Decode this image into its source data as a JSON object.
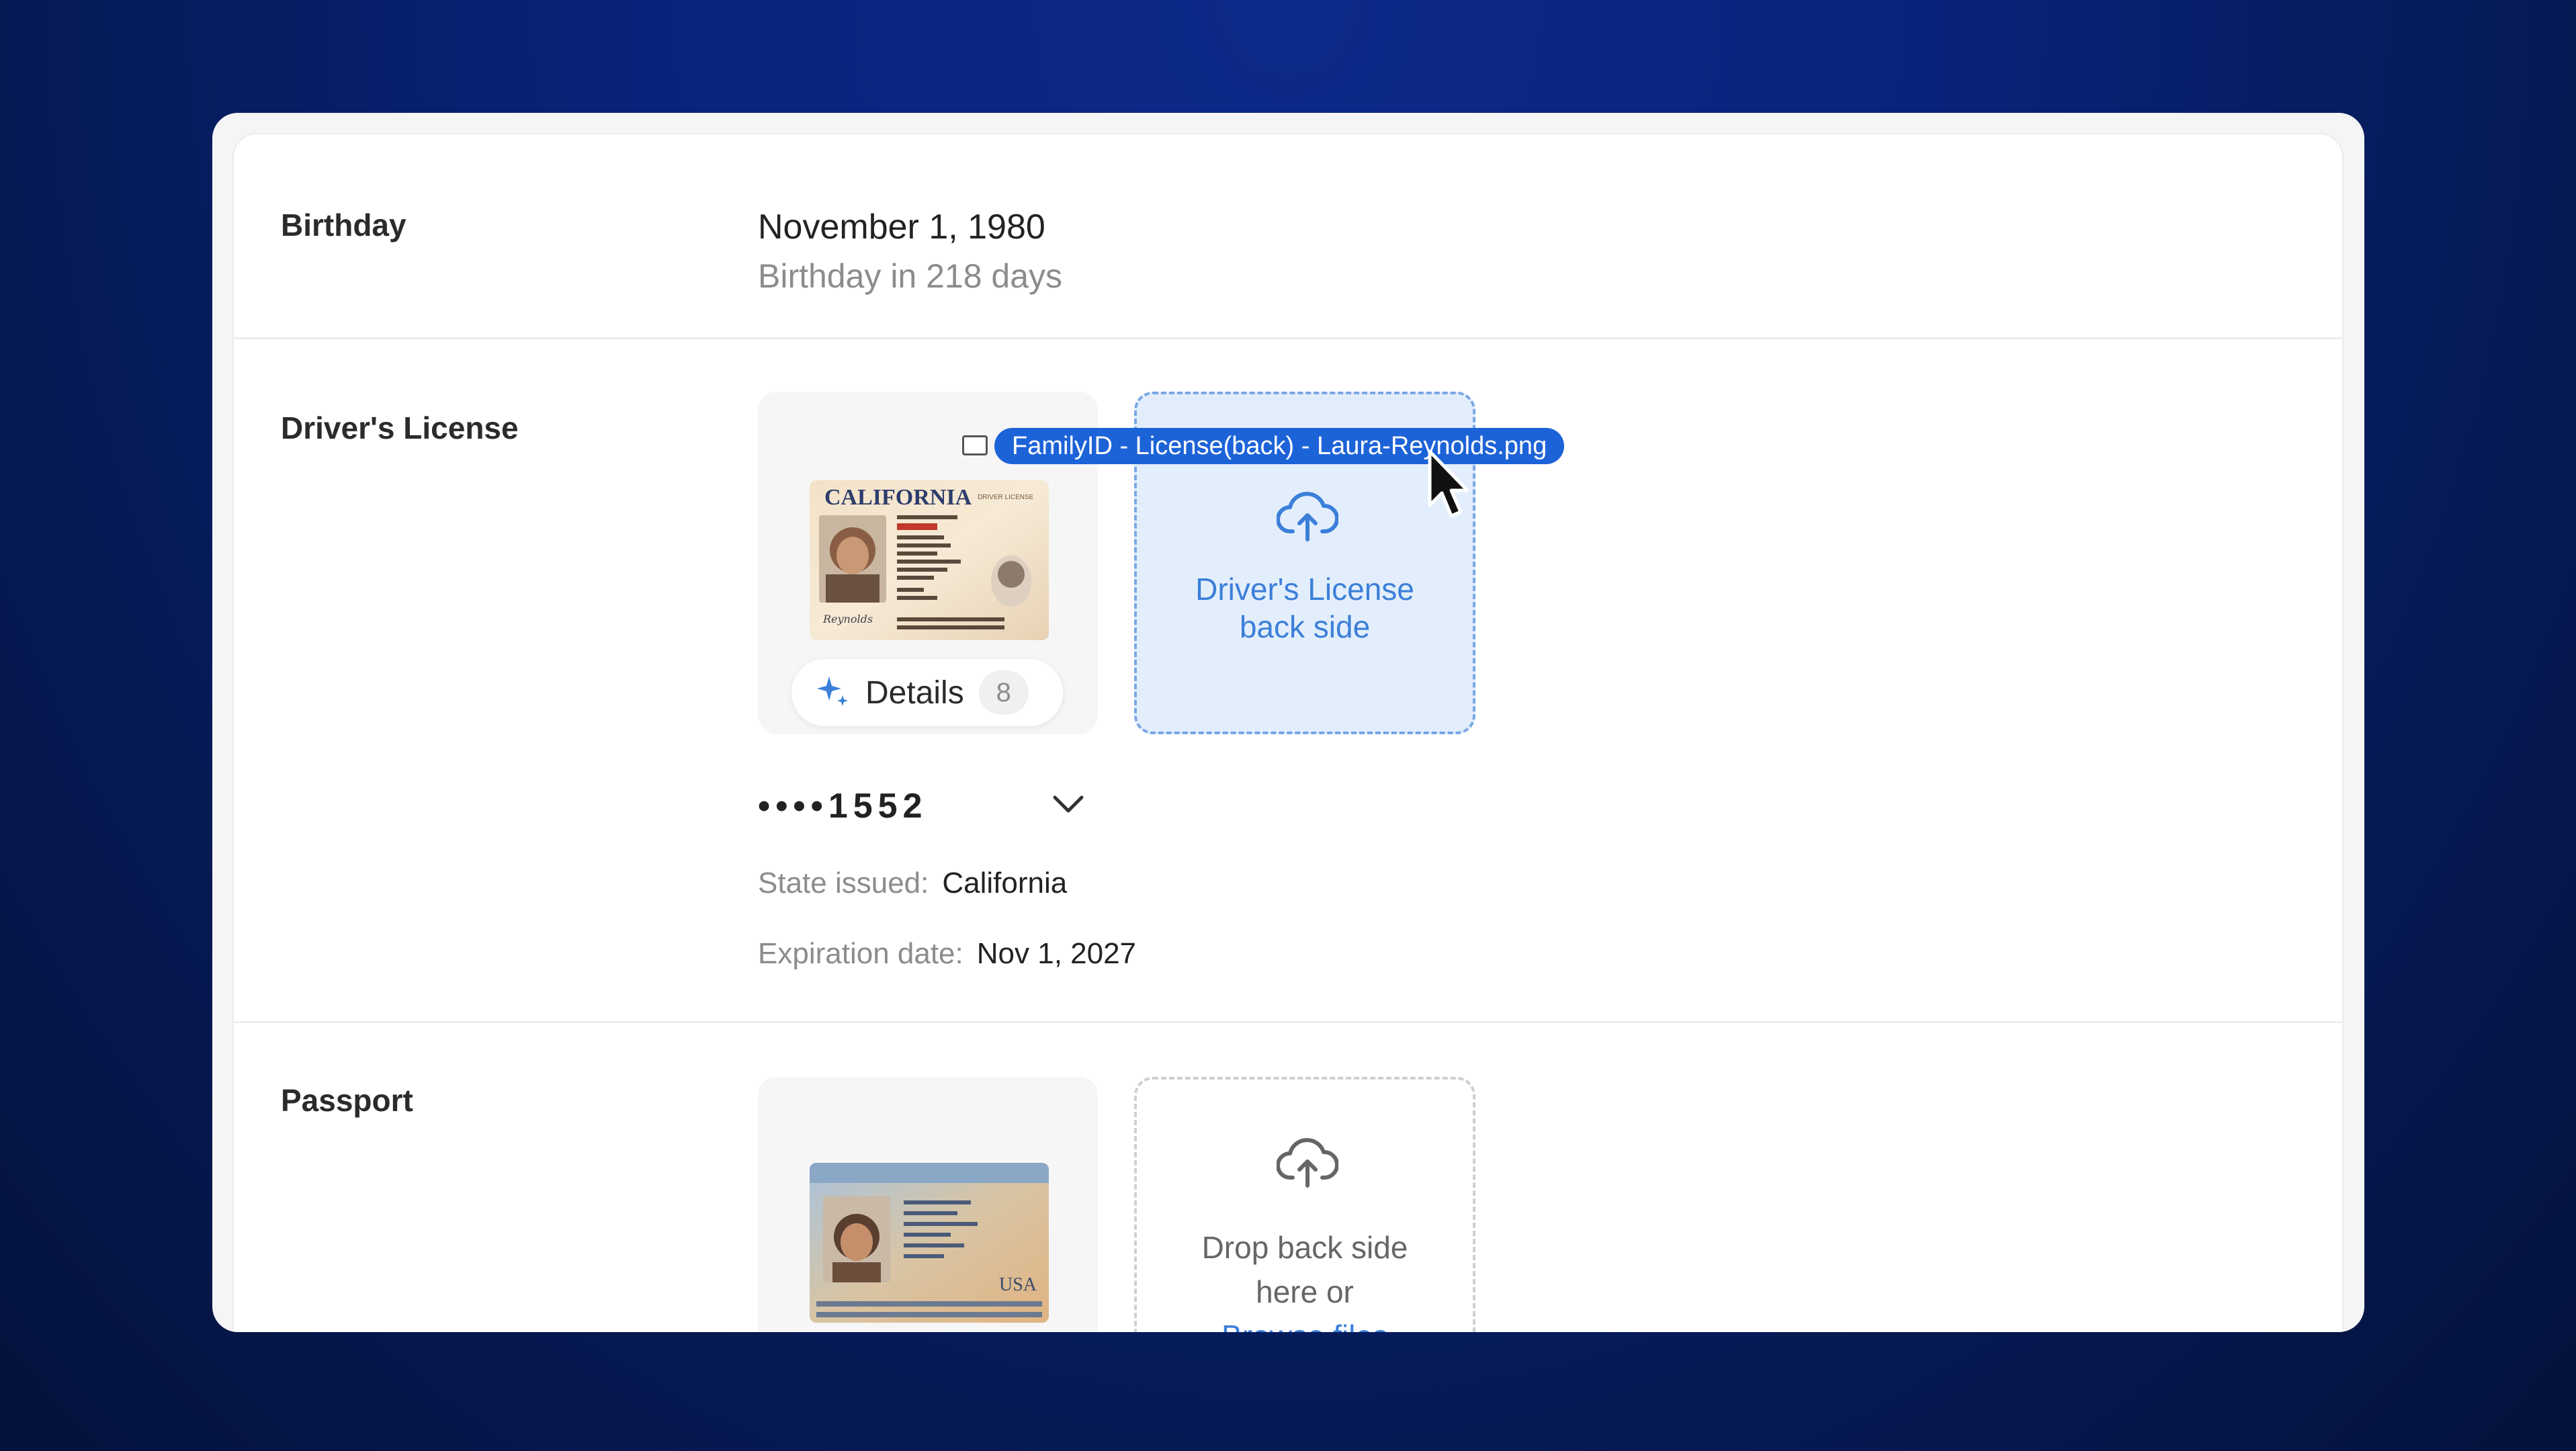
{
  "birthday": {
    "label": "Birthday",
    "date": "November 1, 1980",
    "countdown": "Birthday in 218 days"
  },
  "drivers_license": {
    "label": "Driver's License",
    "card_image": {
      "state_header": "CALIFORNIA",
      "subtitle": "DRIVER LICENSE"
    },
    "details_label": "Details",
    "details_count": "8",
    "drop_zone_text_line1": "Driver's License",
    "drop_zone_text_line2": "back side",
    "masked_number": "••••1552",
    "state_issued_label": "State issued:",
    "state_issued_value": "California",
    "expiration_label": "Expiration date:",
    "expiration_value": "Nov 1, 2027"
  },
  "passport": {
    "label": "Passport",
    "drop_text_line1": "Drop back side",
    "drop_text_line2": "here or",
    "browse_link": "Browse files",
    "passport_image": {
      "country_mark": "USA"
    }
  },
  "drag": {
    "filename": "FamilyID - License(back) - Laura-Reynolds.png"
  },
  "colors": {
    "accent": "#1d63d8",
    "link": "#3b7fd9",
    "background_top": "#0c2a8a",
    "background_bottom": "#04123b"
  }
}
